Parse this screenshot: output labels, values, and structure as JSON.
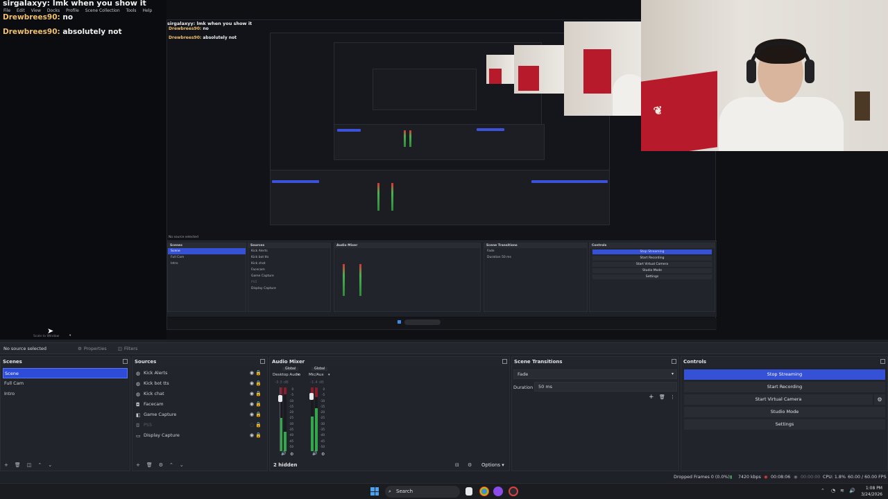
{
  "chat": {
    "title_user": "sirgalaxyy:",
    "title_msg": "lmk when you show it",
    "messages": [
      {
        "user": "Drewbrees90:",
        "text": "no"
      },
      {
        "user": "Drewbrees90:",
        "text": "absolutely not"
      }
    ]
  },
  "menu": [
    "File",
    "Edit",
    "View",
    "Docks",
    "Profile",
    "Scene Collection",
    "Tools",
    "Help"
  ],
  "scale_label": "Scale to Window",
  "source_bar": {
    "no_source": "No source selected",
    "properties": "Properties",
    "filters": "Filters"
  },
  "docks": {
    "scenes": {
      "title": "Scenes",
      "items": [
        "Scene",
        "Full Cam",
        "Intro"
      ],
      "selected": "Scene"
    },
    "sources": {
      "title": "Sources",
      "items": [
        {
          "name": "Kick Alerts",
          "icon": "globe-icon",
          "visible": true
        },
        {
          "name": "Kick bot tts",
          "icon": "globe-icon",
          "visible": true
        },
        {
          "name": "Kick chat",
          "icon": "globe-icon",
          "visible": true
        },
        {
          "name": "Facecam",
          "icon": "camera-icon",
          "visible": true
        },
        {
          "name": "Game Capture",
          "icon": "gamepad-icon",
          "visible": true
        },
        {
          "name": "PS5",
          "icon": "camera-icon",
          "visible": false
        },
        {
          "name": "Display Capture",
          "icon": "monitor-icon",
          "visible": true
        }
      ]
    },
    "audio": {
      "title": "Audio Mixer",
      "channels": [
        {
          "name": "Desktop Audio",
          "global": "Global",
          "db": "-3.3 dB"
        },
        {
          "name": "Mic/Aux",
          "global": "Global",
          "db": "-1.4 dB"
        }
      ],
      "ticks": [
        "0",
        "-5",
        "-10",
        "-15",
        "-20",
        "-25",
        "-30",
        "-35",
        "-40",
        "-45",
        "-50",
        "-55",
        "-60"
      ],
      "hidden": "2 hidden",
      "options": "Options"
    },
    "transitions": {
      "title": "Scene Transitions",
      "transition": "Fade",
      "duration_label": "Duration",
      "duration_value": "50 ms"
    },
    "controls": {
      "title": "Controls",
      "buttons": [
        "Stop Streaming",
        "Start Recording",
        "Start Virtual Camera",
        "Studio Mode",
        "Settings"
      ]
    }
  },
  "status": {
    "dropped": "Dropped Frames 0 (0.0%)",
    "bitrate": "7420 kbps",
    "stream_time": "00:08:06",
    "rec_time": "00:00:00",
    "cpu": "CPU: 1.8%",
    "fps": "60.00 / 60.00 FPS"
  },
  "taskbar": {
    "search": "Search",
    "time": "1:08 PM",
    "date": "3/24/2026"
  },
  "colors": {
    "accent": "#3552d6",
    "chat_user": "#f0c06e",
    "shirt_red": "#b71a2a"
  }
}
